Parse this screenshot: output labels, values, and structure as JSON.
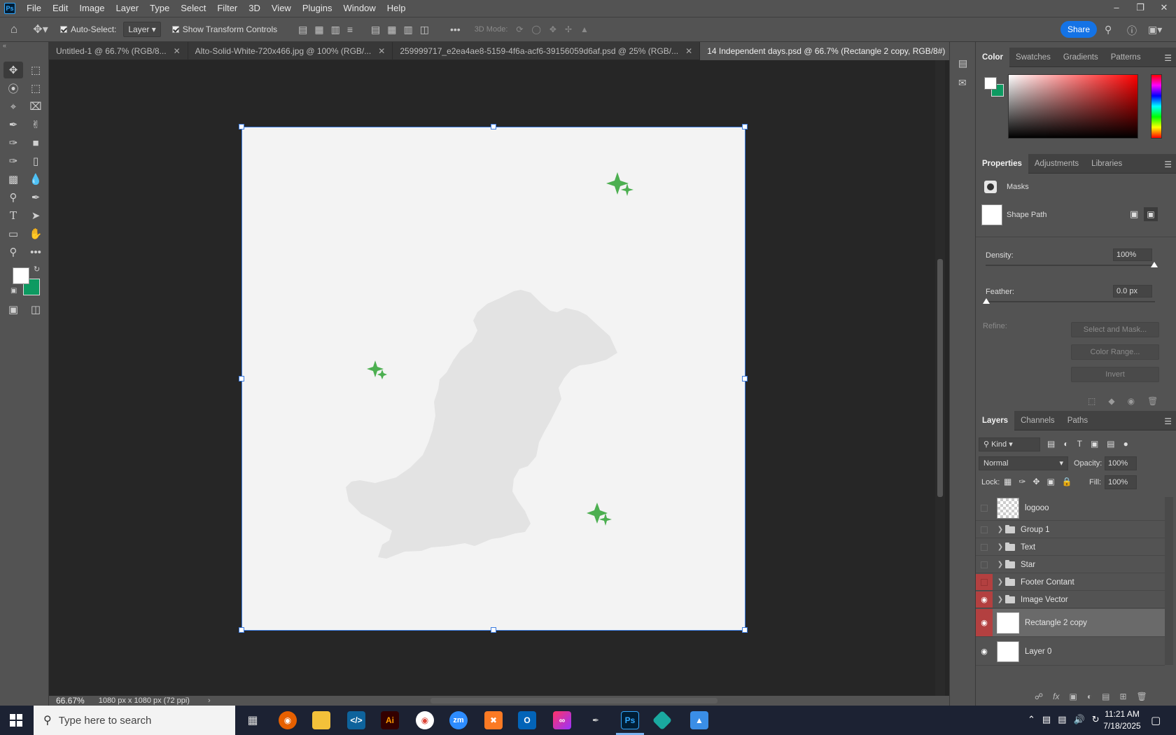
{
  "app": {
    "logo": "Ps"
  },
  "menu": [
    "File",
    "Edit",
    "Image",
    "Layer",
    "Type",
    "Select",
    "Filter",
    "3D",
    "View",
    "Plugins",
    "Window",
    "Help"
  ],
  "options": {
    "auto_select": "Auto-Select:",
    "auto_select_value": "Layer",
    "show_transform": "Show Transform Controls",
    "three_d_mode": "3D Mode:",
    "share": "Share"
  },
  "tabs": [
    {
      "label": "Untitled-1 @ 66.7% (RGB/8..."
    },
    {
      "label": "Alto-Solid-White-720x466.jpg @ 100% (RGB/..."
    },
    {
      "label": "259999717_e2ea4ae8-5159-4f6a-acf6-39156059d6af.psd @ 25% (RGB/..."
    },
    {
      "label": "14 Independent days.psd @ 66.7% (Rectangle 2 copy, RGB/8#)"
    }
  ],
  "status": {
    "zoom": "66.67%",
    "doc_info": "1080 px x 1080 px (72 ppi)"
  },
  "colors": {
    "foreground": "#ffffff",
    "background": "#0d9a61",
    "accent": "#1473e6",
    "sparkle": "#4caf50"
  },
  "color_panel": {
    "tabs": [
      "Color",
      "Swatches",
      "Gradients",
      "Patterns"
    ]
  },
  "properties": {
    "tabs": [
      "Properties",
      "Adjustments",
      "Libraries"
    ],
    "masks": "Masks",
    "shape_path": "Shape Path",
    "density_label": "Density:",
    "density_value": "100%",
    "feather_label": "Feather:",
    "feather_value": "0.0 px",
    "refine_label": "Refine:",
    "buttons": [
      "Select and Mask...",
      "Color Range...",
      "Invert"
    ]
  },
  "layers_panel": {
    "tabs": [
      "Layers",
      "Channels",
      "Paths"
    ],
    "kind": "Kind",
    "blend": "Normal",
    "opacity_label": "Opacity:",
    "opacity_value": "100%",
    "lock_label": "Lock:",
    "fill_label": "Fill:",
    "fill_value": "100%",
    "layers": [
      {
        "name": "logooo"
      },
      {
        "name": "Group 1"
      },
      {
        "name": "Text"
      },
      {
        "name": "Star"
      },
      {
        "name": "Footer Contant"
      },
      {
        "name": "Image Vector"
      },
      {
        "name": "Rectangle 2 copy"
      },
      {
        "name": "Layer 0"
      }
    ]
  },
  "taskbar": {
    "search": "Type here to search",
    "time": "11:21 AM",
    "date": "7/18/2025",
    "app_labels": [
      "Ai",
      "zm",
      "Ps"
    ]
  }
}
